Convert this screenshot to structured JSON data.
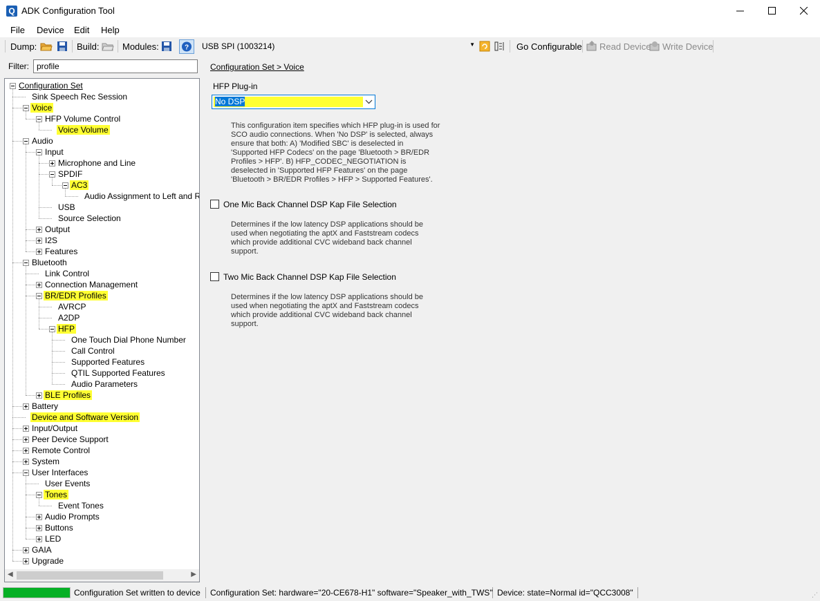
{
  "window": {
    "title": "ADK Configuration Tool"
  },
  "menu": [
    "File",
    "Device",
    "Edit",
    "Help"
  ],
  "toolbar": {
    "dump_label": "Dump:",
    "build_label": "Build:",
    "modules_label": "Modules:",
    "device": "USB SPI (1003214)",
    "go_configurable": "Go Configurable",
    "read_device": "Read Device",
    "write_device": "Write Device"
  },
  "filter": {
    "label": "Filter:",
    "value": "profile"
  },
  "tree": [
    {
      "label": "Configuration Set",
      "level": 0,
      "expander": "minus",
      "selected": true
    },
    {
      "label": "Sink Speech Rec Session",
      "level": 1
    },
    {
      "label": "Voice",
      "level": 1,
      "expander": "minus",
      "highlight": true
    },
    {
      "label": "HFP Volume Control",
      "level": 2,
      "expander": "minus"
    },
    {
      "label": "Voice Volume",
      "level": 3,
      "highlight": true
    },
    {
      "label": "Audio",
      "level": 1,
      "expander": "minus"
    },
    {
      "label": "Input",
      "level": 2,
      "expander": "minus"
    },
    {
      "label": "Microphone and Line",
      "level": 3,
      "expander": "plus"
    },
    {
      "label": "SPDIF",
      "level": 3,
      "expander": "minus"
    },
    {
      "label": "AC3",
      "level": 4,
      "expander": "minus",
      "highlight": true
    },
    {
      "label": "Audio Assignment to Left and Right",
      "level": 5
    },
    {
      "label": "USB",
      "level": 3
    },
    {
      "label": "Source Selection",
      "level": 3
    },
    {
      "label": "Output",
      "level": 2,
      "expander": "plus"
    },
    {
      "label": "I2S",
      "level": 2,
      "expander": "plus"
    },
    {
      "label": "Features",
      "level": 2,
      "expander": "plus"
    },
    {
      "label": "Bluetooth",
      "level": 1,
      "expander": "minus"
    },
    {
      "label": "Link Control",
      "level": 2
    },
    {
      "label": "Connection Management",
      "level": 2,
      "expander": "plus"
    },
    {
      "label": "BR/EDR Profiles",
      "level": 2,
      "expander": "minus",
      "highlight": true
    },
    {
      "label": "AVRCP",
      "level": 3
    },
    {
      "label": "A2DP",
      "level": 3
    },
    {
      "label": "HFP",
      "level": 3,
      "expander": "minus",
      "highlight": true
    },
    {
      "label": "One Touch Dial Phone Number",
      "level": 4
    },
    {
      "label": "Call Control",
      "level": 4
    },
    {
      "label": "Supported Features",
      "level": 4
    },
    {
      "label": "QTIL Supported Features",
      "level": 4
    },
    {
      "label": "Audio Parameters",
      "level": 4
    },
    {
      "label": "BLE Profiles",
      "level": 2,
      "expander": "plus",
      "highlight": true
    },
    {
      "label": "Battery",
      "level": 1,
      "expander": "plus"
    },
    {
      "label": "Device and Software Version",
      "level": 1,
      "highlight": true
    },
    {
      "label": "Input/Output",
      "level": 1,
      "expander": "plus"
    },
    {
      "label": "Peer Device Support",
      "level": 1,
      "expander": "plus"
    },
    {
      "label": "Remote Control",
      "level": 1,
      "expander": "plus"
    },
    {
      "label": "System",
      "level": 1,
      "expander": "plus"
    },
    {
      "label": "User Interfaces",
      "level": 1,
      "expander": "minus"
    },
    {
      "label": "User Events",
      "level": 2
    },
    {
      "label": "Tones",
      "level": 2,
      "expander": "minus",
      "highlight": true
    },
    {
      "label": "Event Tones",
      "level": 3
    },
    {
      "label": "Audio Prompts",
      "level": 2,
      "expander": "plus"
    },
    {
      "label": "Buttons",
      "level": 2,
      "expander": "plus"
    },
    {
      "label": "LED",
      "level": 2,
      "expander": "plus"
    },
    {
      "label": "GAIA",
      "level": 1,
      "expander": "plus"
    },
    {
      "label": "Upgrade",
      "level": 1,
      "expander": "plus"
    }
  ],
  "content": {
    "breadcrumb": "Configuration Set > Voice",
    "hfp_plugin": {
      "label": "HFP Plug-in",
      "value": "No DSP",
      "description": "This configuration item specifies which HFP plug-in is used for\nSCO audio connections. When 'No DSP' is selected, always\nensure that both: A) 'Modified SBC' is deselected in\n'Supported HFP Codecs' on the page 'Bluetooth > BR/EDR\nProfiles > HFP'. B) HFP_CODEC_NEGOTIATION is\ndeselected in 'Supported HFP Features' on the page\n'Bluetooth > BR/EDR Profiles > HFP > Supported Features'."
    },
    "one_mic": {
      "label": "One Mic Back Channel DSP Kap File Selection",
      "checked": false,
      "description": "Determines if the low latency DSP applications should be\nused when negotiating the aptX and Faststream codecs\nwhich provide additional CVC wideband back channel\nsupport."
    },
    "two_mic": {
      "label": "Two Mic Back Channel DSP Kap File Selection",
      "checked": false,
      "description": "Determines if the low latency DSP applications should be\nused when negotiating the aptX and Faststream codecs\nwhich provide additional CVC wideband back channel\nsupport."
    }
  },
  "status": {
    "progress_percent": 100,
    "message": "Configuration Set written to device",
    "config_set": "Configuration Set:  hardware=\"20-CE678-H1\" software=\"Speaker_with_TWS\"",
    "device": "Device:  state=Normal id=\"QCC3008\""
  },
  "colors": {
    "highlight": "#ffff33",
    "accent": "#0078d7",
    "progress": "#06b025"
  }
}
